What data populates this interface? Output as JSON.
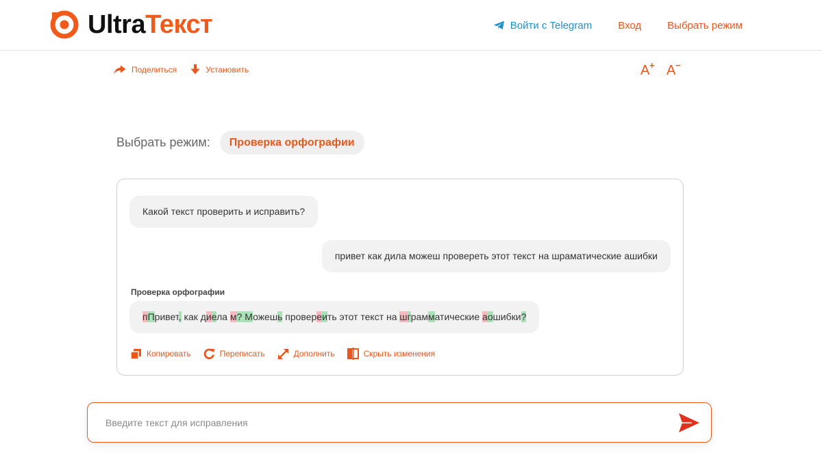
{
  "brand": {
    "name_part1": "Ultra",
    "name_part2": "Текст",
    "accent_color": "#e8571c",
    "telegram_color": "#1e90c8"
  },
  "nav": {
    "telegram_label": "Войти с Telegram",
    "login_label": "Вход",
    "select_mode_label": "Выбрать режим"
  },
  "toolbar": {
    "share_label": "Поделиться",
    "install_label": "Установить",
    "font_increase_letter": "A",
    "font_increase_mod": "+",
    "font_decrease_letter": "A",
    "font_decrease_mod": "−"
  },
  "mode": {
    "label": "Выбрать режим:",
    "current": "Проверка орфографии"
  },
  "chat": {
    "bot_question": "Какой текст проверить и исправить?",
    "user_message": "привет как дила можеш провереть этот текст на шраматические ашибки",
    "result_title": "Проверка орфографии",
    "result_segments": [
      {
        "t": "п",
        "k": "del"
      },
      {
        "t": "П",
        "k": "ins"
      },
      {
        "t": "ривет",
        "k": ""
      },
      {
        "t": ",",
        "k": "ins"
      },
      {
        "t": " как д",
        "k": ""
      },
      {
        "t": "и",
        "k": "del"
      },
      {
        "t": "е",
        "k": "ins"
      },
      {
        "t": "ла ",
        "k": ""
      },
      {
        "t": "м",
        "k": "del"
      },
      {
        "t": "? М",
        "k": "ins"
      },
      {
        "t": "ожеш",
        "k": ""
      },
      {
        "t": "ь",
        "k": "ins"
      },
      {
        "t": " провер",
        "k": ""
      },
      {
        "t": "е",
        "k": "del"
      },
      {
        "t": "и",
        "k": "ins"
      },
      {
        "t": "ть этот текст на ",
        "k": ""
      },
      {
        "t": "ш",
        "k": "del"
      },
      {
        "t": "г",
        "k": "ins"
      },
      {
        "t": "рам",
        "k": ""
      },
      {
        "t": "м",
        "k": "ins"
      },
      {
        "t": "атические ",
        "k": ""
      },
      {
        "t": "а",
        "k": "del"
      },
      {
        "t": "о",
        "k": "ins"
      },
      {
        "t": "шибки",
        "k": ""
      },
      {
        "t": "?",
        "k": "ins"
      }
    ],
    "actions": {
      "copy": "Копировать",
      "rewrite": "Переписать",
      "expand": "Дополнить",
      "hide_changes": "Скрыть изменения"
    }
  },
  "input": {
    "placeholder": "Введите текст для исправления",
    "value": ""
  },
  "icons": [
    "logo-icon",
    "telegram-icon",
    "share-icon",
    "install-icon",
    "copy-icon",
    "rewrite-icon",
    "expand-icon",
    "hide-changes-icon",
    "send-icon"
  ]
}
